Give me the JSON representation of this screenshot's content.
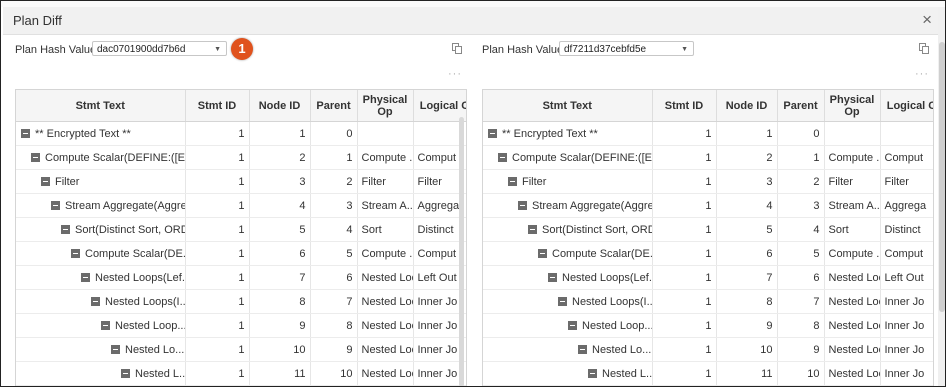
{
  "dialog": {
    "title": "Plan Diff",
    "close_icon": "×"
  },
  "callout": {
    "number": "1",
    "color": "#e0521d"
  },
  "header_label": "Plan Hash Value",
  "more_label": "···",
  "columns": [
    "Stmt Text",
    "Stmt ID",
    "Node ID",
    "Parent",
    "Physical Op",
    "Logical C"
  ],
  "rows": [
    {
      "text": "** Encrypted Text **",
      "stmt": "1",
      "node": "1",
      "parent": "0",
      "phys": "",
      "log": ""
    },
    {
      "text": "Compute Scalar(DEFINE:([Ex...",
      "stmt": "1",
      "node": "2",
      "parent": "1",
      "phys": "Compute ...",
      "log": "Comput"
    },
    {
      "text": "Filter",
      "stmt": "1",
      "node": "3",
      "parent": "2",
      "phys": "Filter",
      "log": "Filter"
    },
    {
      "text": "Stream Aggregate(Aggre...",
      "stmt": "1",
      "node": "4",
      "parent": "3",
      "phys": "Stream A...",
      "log": "Aggrega"
    },
    {
      "text": "Sort(Distinct Sort, ORD...",
      "stmt": "1",
      "node": "5",
      "parent": "4",
      "phys": "Sort",
      "log": "Distinct"
    },
    {
      "text": "Compute Scalar(DE...",
      "stmt": "1",
      "node": "6",
      "parent": "5",
      "phys": "Compute ...",
      "log": "Comput"
    },
    {
      "text": "Nested Loops(Lef...",
      "stmt": "1",
      "node": "7",
      "parent": "6",
      "phys": "Nested Loo...",
      "log": "Left Out"
    },
    {
      "text": "Nested Loops(I...",
      "stmt": "1",
      "node": "8",
      "parent": "7",
      "phys": "Nested Loo...",
      "log": "Inner Jo"
    },
    {
      "text": "Nested Loop...",
      "stmt": "1",
      "node": "9",
      "parent": "8",
      "phys": "Nested Loo...",
      "log": "Inner Jo"
    },
    {
      "text": "Nested Lo...",
      "stmt": "1",
      "node": "10",
      "parent": "9",
      "phys": "Nested Loo...",
      "log": "Inner Jo"
    },
    {
      "text": "Nested L...",
      "stmt": "1",
      "node": "11",
      "parent": "10",
      "phys": "Nested Loo...",
      "log": "Inner Jo"
    }
  ],
  "indents": [
    0,
    1,
    2,
    3,
    4,
    5,
    6,
    7,
    8,
    9,
    10
  ],
  "left": {
    "hash_value": "dac0701900dd7b6d"
  },
  "right": {
    "hash_value": "df7211d37cebfd5e"
  }
}
